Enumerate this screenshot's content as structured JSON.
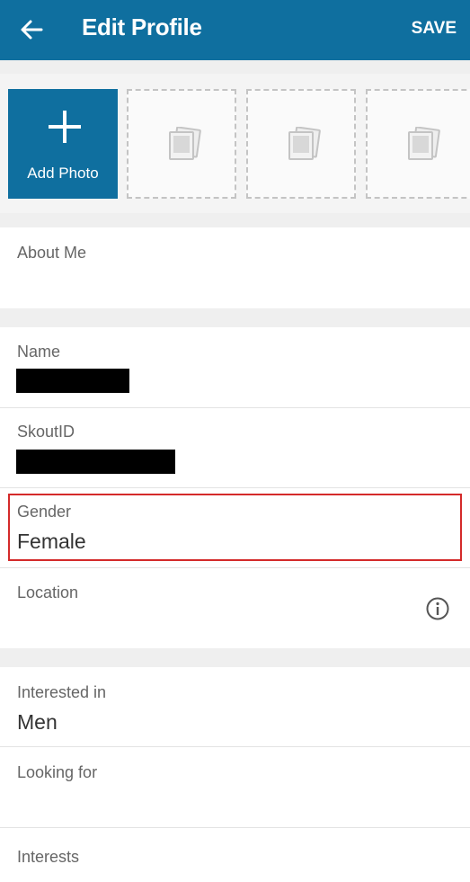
{
  "header": {
    "title": "Edit Profile",
    "save_label": "SAVE"
  },
  "photos": {
    "add_label": "Add Photo",
    "empty_slots": 3
  },
  "fields": {
    "about_me": {
      "label": "About Me",
      "value": ""
    },
    "name": {
      "label": "Name",
      "value": ""
    },
    "skout_id": {
      "label": "SkoutID",
      "value": ""
    },
    "gender": {
      "label": "Gender",
      "value": "Female"
    },
    "location": {
      "label": "Location",
      "value": ""
    },
    "interested_in": {
      "label": "Interested in",
      "value": "Men"
    },
    "looking_for": {
      "label": "Looking for",
      "value": ""
    },
    "interests": {
      "label": "Interests",
      "value": ""
    }
  },
  "colors": {
    "header": "#0f6f9f",
    "highlight": "#d42a2a",
    "background": "#efefef"
  }
}
